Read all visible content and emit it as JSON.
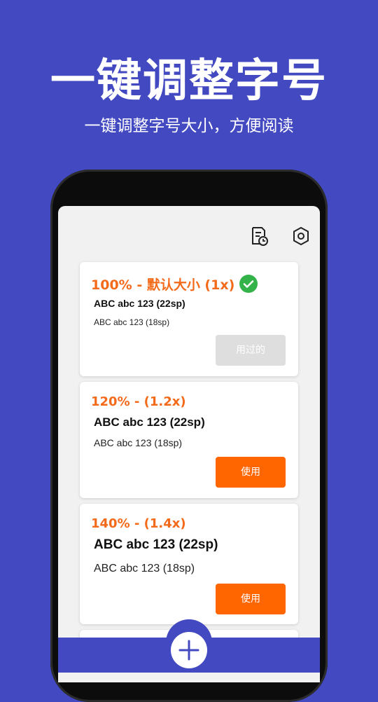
{
  "promo": {
    "headline": "一键调整字号",
    "subline": "一键调整字号大小，方便阅读"
  },
  "toolbar": {
    "history_icon": "history-doc-icon",
    "settings_icon": "settings-hex-icon"
  },
  "options": [
    {
      "title": "100% - 默认大小 (1x)",
      "sample_large": "ABC abc 123 (22sp)",
      "sample_small": "ABC abc 123 (18sp)",
      "button_label": "用过的",
      "selected": true
    },
    {
      "title": "120% - (1.2x)",
      "sample_large": "ABC abc 123 (22sp)",
      "sample_small": "ABC abc 123 (18sp)",
      "button_label": "使用",
      "selected": false
    },
    {
      "title": "140% - (1.4x)",
      "sample_large": "ABC abc 123 (22sp)",
      "sample_small": "ABC abc 123 (18sp)",
      "button_label": "使用",
      "selected": false
    }
  ],
  "colors": {
    "background": "#4349c0",
    "accent": "#ff6600",
    "title": "#f36a1a",
    "check": "#34b34a",
    "disabled_button": "#dedede"
  }
}
